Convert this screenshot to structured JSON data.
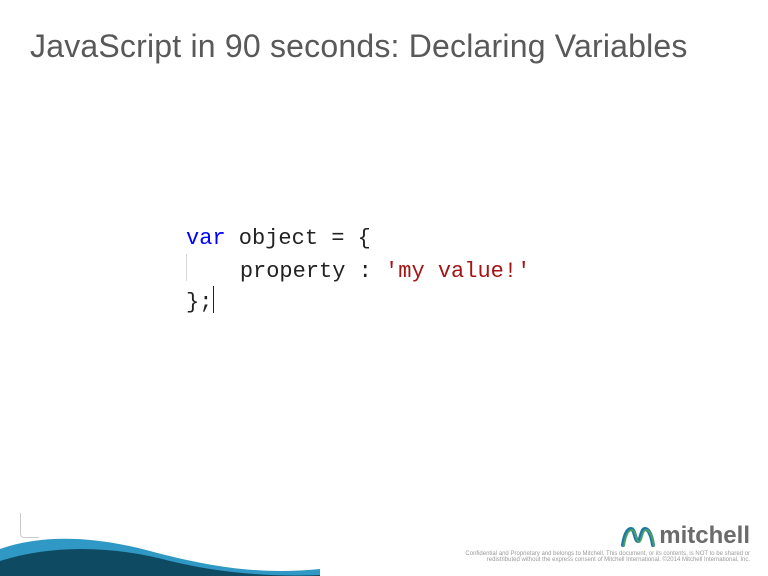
{
  "title": "JavaScript in 90 seconds: Declaring Variables",
  "code": {
    "keyword": "var",
    "line1_rest": " object = {",
    "line2_indent": "    ",
    "line2_prop": "property : ",
    "line2_str": "'my value!'",
    "line3": "};"
  },
  "brand": {
    "name": "mitchell"
  },
  "disclaimer": "Confidential and Proprietary and belongs to Mitchell. This document, or its contents, is NOT to be shared or redistributed without the express consent of Mitchell International. ©2014 Mitchell International, Inc."
}
